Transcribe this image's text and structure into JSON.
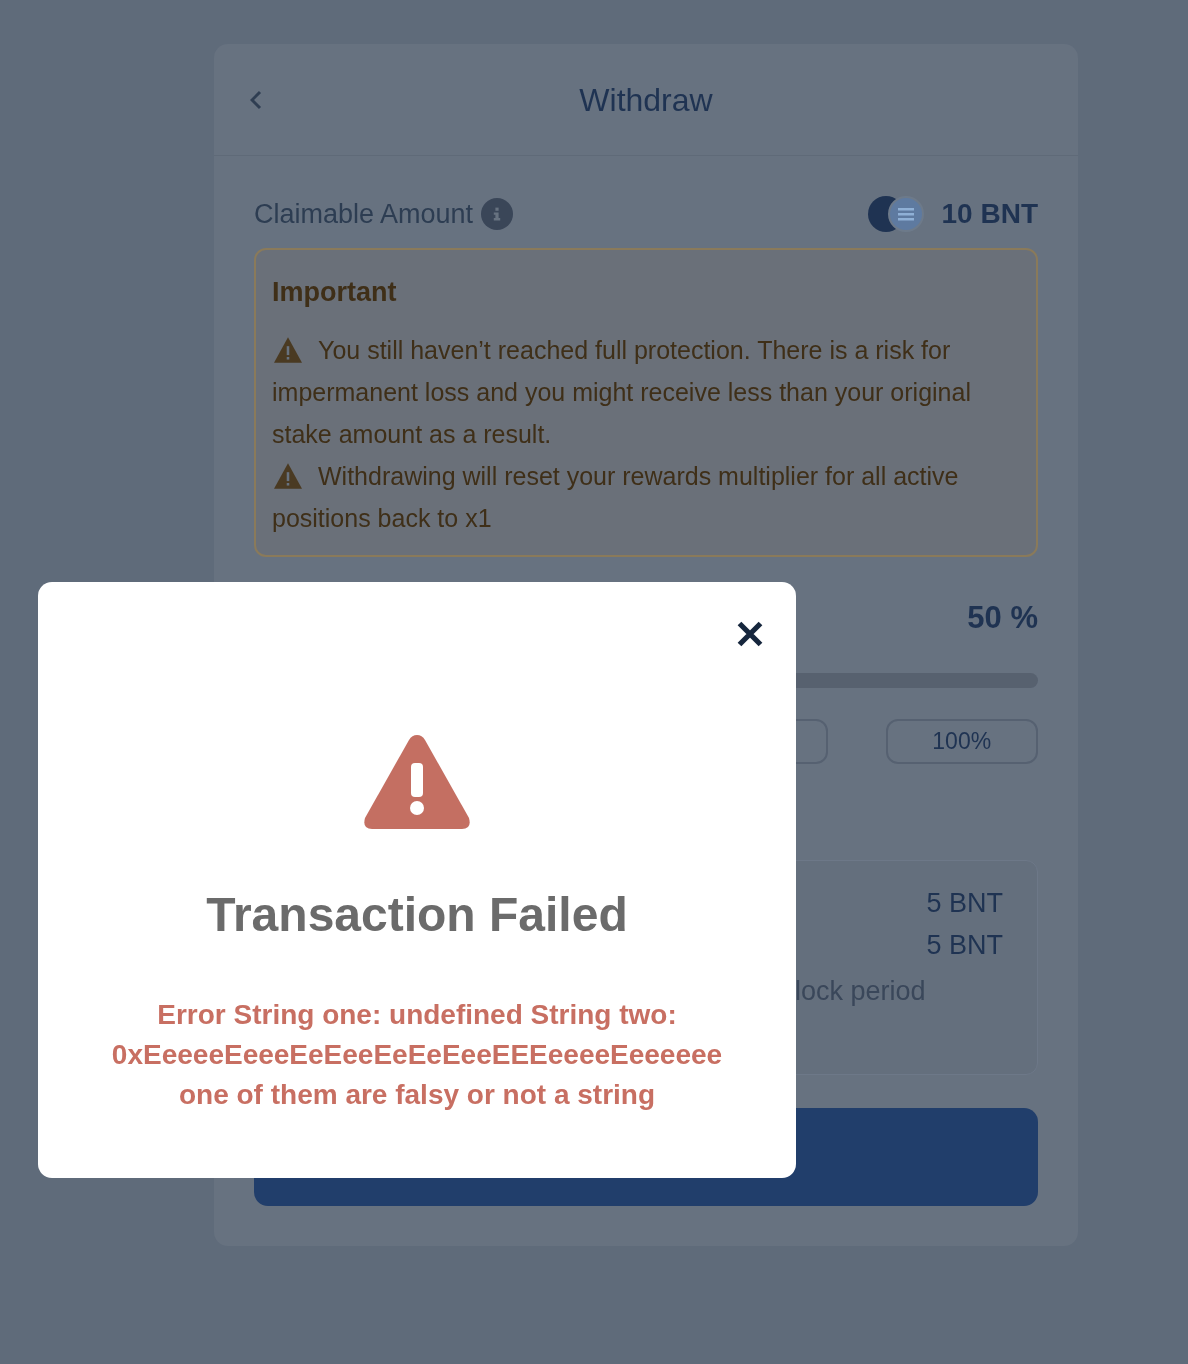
{
  "card": {
    "title": "Withdraw",
    "claimable": {
      "label": "Claimable Amount",
      "amount": "10 BNT"
    },
    "notice": {
      "title": "Important",
      "warnings": [
        "You still haven’t reached full protection. There is a risk for impermanent loss and you might receive less than your original stake amount as a result.",
        "Withdrawing will reset your rewards multiplier for all active positions back to x1"
      ]
    },
    "percent_reading": "50 %",
    "percent_buttons": [
      {
        "label": "100%"
      }
    ],
    "details": {
      "values": [
        "5 BNT",
        "5 BNT"
      ],
      "note": "lock period"
    }
  },
  "modal": {
    "title": "Transaction Failed",
    "error_lines": [
      "Error String one: undefined String two:",
      "0xEeeeeEeeeEeEeeEeEeEeeEEEeeeeEeeeeee",
      "one of them are falsy or not a string"
    ]
  }
}
